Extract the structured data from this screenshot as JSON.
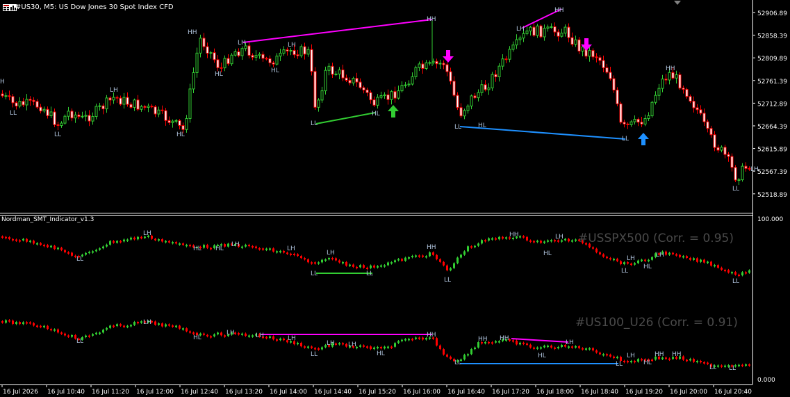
{
  "window": {
    "title": "#US30, M5:  US Dow Jones 30 Spot Index CFD",
    "menu_icons": [
      "chart-menu-icon",
      "timeframe-icon"
    ]
  },
  "indicator": {
    "name": "Nordman_SMT_Indicator_v1.3",
    "scale_top": "100.000",
    "scale_bottom": "0.000",
    "symbol1": "#USSPX500 (Corr. = 0.95)",
    "symbol2": "#US100_U26 (Corr. = 0.91)"
  },
  "price_axis": [
    "52906.89",
    "52858.39",
    "52809.89",
    "52761.39",
    "52712.89",
    "52664.39",
    "52615.89",
    "52567.39",
    "52518.89"
  ],
  "time_axis": [
    "16 Jul 2026",
    "16 Jul 10:40",
    "16 Jul 11:20",
    "16 Jul 12:00",
    "16 Jul 12:40",
    "16 Jul 13:20",
    "16 Jul 14:00",
    "16 Jul 14:40",
    "16 Jul 15:20",
    "16 Jul 16:00",
    "16 Jul 16:40",
    "16 Jul 17:20",
    "16 Jul 18:00",
    "16 Jul 18:40",
    "16 Jul 19:20",
    "16 Jul 20:00",
    "16 Jul 20:40"
  ],
  "colors": {
    "bg": "#000000",
    "bull": "#32cd32",
    "bear": "#ff0000",
    "label": "#b0c4de",
    "magenta": "#ff00ff",
    "blue": "#1e90ff",
    "green": "#32cd32",
    "arrow_green": "#32cd32",
    "arrow_magenta": "#ff00ff",
    "arrow_blue": "#1e90ff"
  },
  "main_labels": [
    {
      "t": "H"
    },
    {
      "t": "LL"
    },
    {
      "t": "LL"
    },
    {
      "t": "LH"
    },
    {
      "t": "HL"
    },
    {
      "t": "HH"
    },
    {
      "t": "LH"
    },
    {
      "t": "HL"
    },
    {
      "t": "LH"
    },
    {
      "t": "HL"
    },
    {
      "t": "LL"
    },
    {
      "t": "HL"
    },
    {
      "t": "HH"
    },
    {
      "t": "LL"
    },
    {
      "t": "HL"
    },
    {
      "t": "LH"
    },
    {
      "t": "HH"
    },
    {
      "t": "LL"
    },
    {
      "t": "HH"
    },
    {
      "t": "LL"
    },
    {
      "t": "LH"
    }
  ]
}
